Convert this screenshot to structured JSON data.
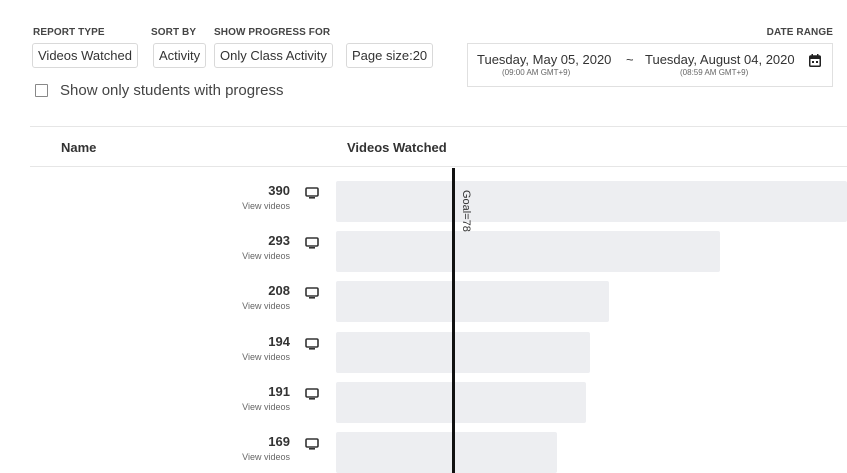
{
  "filters": {
    "report_type": {
      "label": "REPORT TYPE",
      "value": "Videos Watched"
    },
    "sort_by": {
      "label": "SORT BY",
      "value": "Activity"
    },
    "show_progress_for": {
      "label": "SHOW PROGRESS FOR",
      "value": "Only Class Activity"
    },
    "page_size": {
      "value": "Page size:20"
    },
    "date_range": {
      "label": "DATE RANGE",
      "start": "Tuesday, May 05, 2020",
      "start_time": "(09:00 AM GMT+9)",
      "separator": "~",
      "end": "Tuesday, August 04, 2020",
      "end_time": "(08:59 AM GMT+9)",
      "icon": "calendar-icon"
    }
  },
  "checkbox": {
    "label": "Show only students with progress",
    "checked": false
  },
  "table": {
    "columns": {
      "name": "Name",
      "videos_watched": "Videos Watched"
    },
    "goal_label": "Goal=78",
    "goal_value": 78,
    "row_icon": "monitor-icon",
    "rows": [
      {
        "value": 390,
        "link": "View videos"
      },
      {
        "value": 293,
        "link": "View videos"
      },
      {
        "value": 208,
        "link": "View videos"
      },
      {
        "value": 194,
        "link": "View videos"
      },
      {
        "value": 191,
        "link": "View videos"
      },
      {
        "value": 169,
        "link": "View videos"
      }
    ]
  },
  "colors": {
    "bar": "#edeef1",
    "goal_line": "#111111",
    "divider": "#e6e6e6"
  }
}
